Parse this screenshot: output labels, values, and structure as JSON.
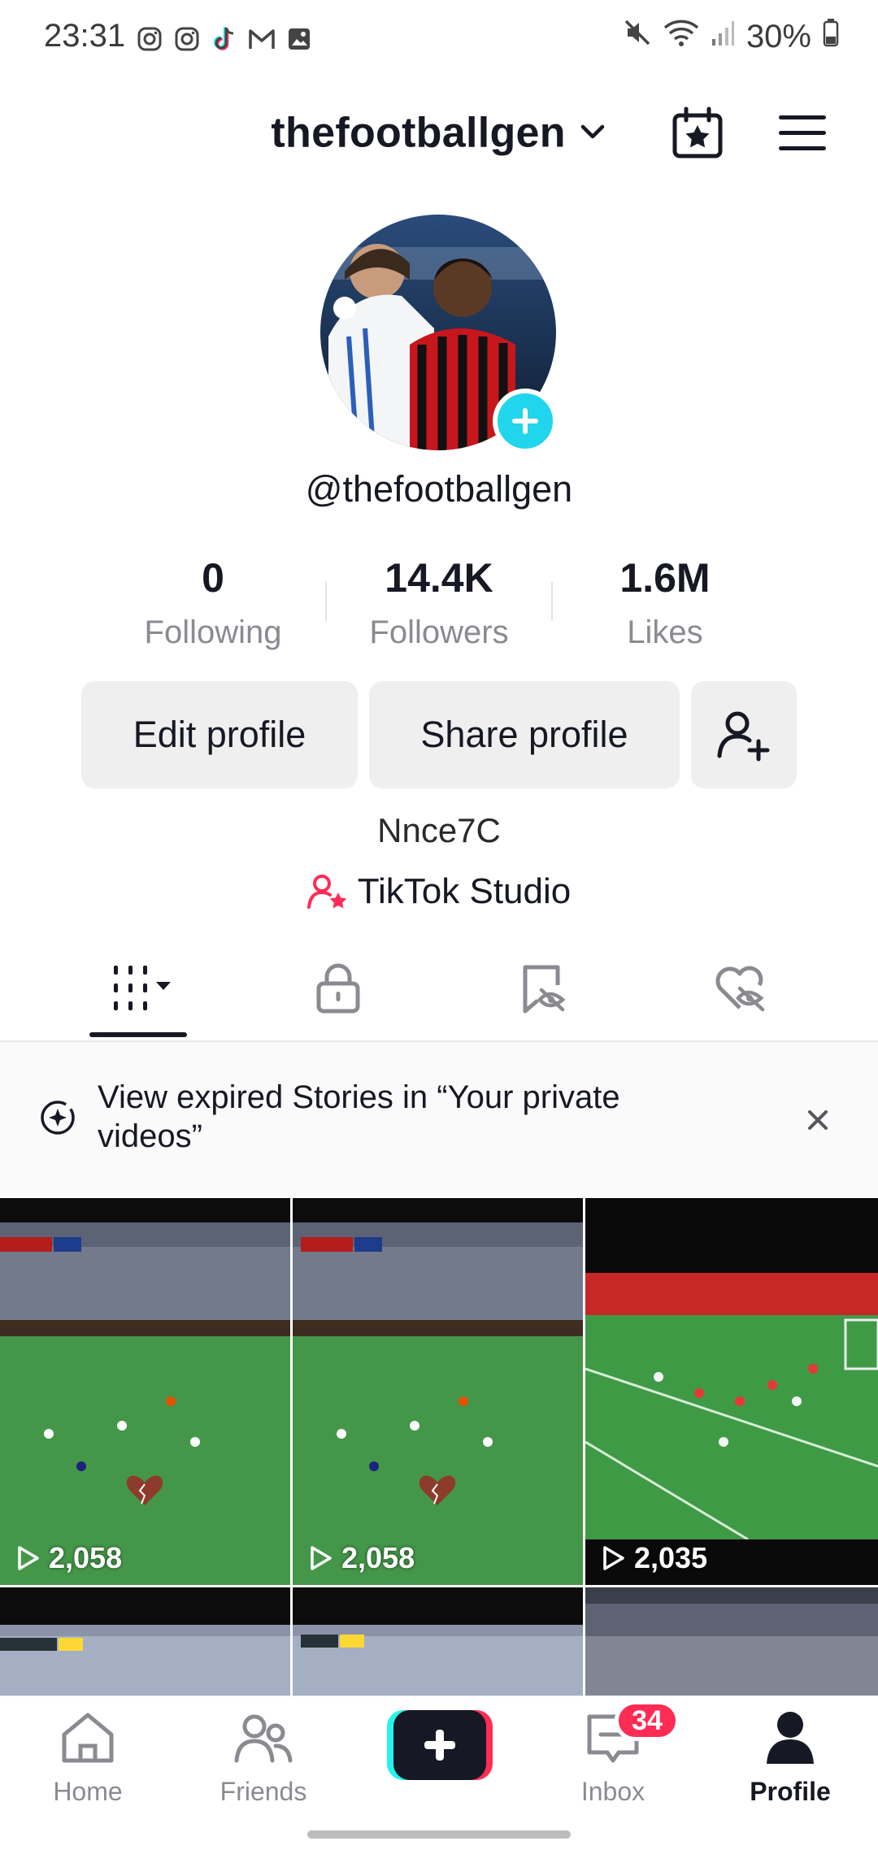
{
  "status_bar": {
    "time": "23:31",
    "battery": "30%",
    "left_icons": [
      "instagram-icon",
      "instagram-icon",
      "tiktok-icon",
      "gmail-icon",
      "gallery-icon"
    ],
    "right_icons": [
      "mute-icon",
      "wifi-icon",
      "signal-icon",
      "battery-icon"
    ]
  },
  "header": {
    "username": "thefootballgen",
    "dropdown_icon": "chevron-down-icon",
    "calendar_icon": "calendar-star-icon",
    "menu_icon": "hamburger-menu-icon"
  },
  "profile": {
    "handle": "@thefootballgen",
    "stats": [
      {
        "value": "0",
        "label": "Following"
      },
      {
        "value": "14.4K",
        "label": "Followers"
      },
      {
        "value": "1.6M",
        "label": "Likes"
      }
    ],
    "buttons": {
      "edit": "Edit profile",
      "share": "Share profile"
    },
    "bio": "Nnce7C",
    "studio_label": "TikTok Studio"
  },
  "tabs": [
    "videos-grid-icon",
    "private-lock-icon",
    "reposts-icon",
    "liked-icon"
  ],
  "banner": {
    "text": "View expired Stories in “Your private videos”"
  },
  "videos": [
    {
      "views": "2,058"
    },
    {
      "views": "2,058"
    },
    {
      "views": "2,035"
    }
  ],
  "colors": {
    "accent_cyan": "#20d5ec",
    "accent_red": "#fe2c55",
    "text": "#161823",
    "muted": "#8a8b91"
  },
  "nav": {
    "items": [
      "Home",
      "Friends",
      "Inbox",
      "Profile"
    ],
    "inbox_badge": "34"
  }
}
